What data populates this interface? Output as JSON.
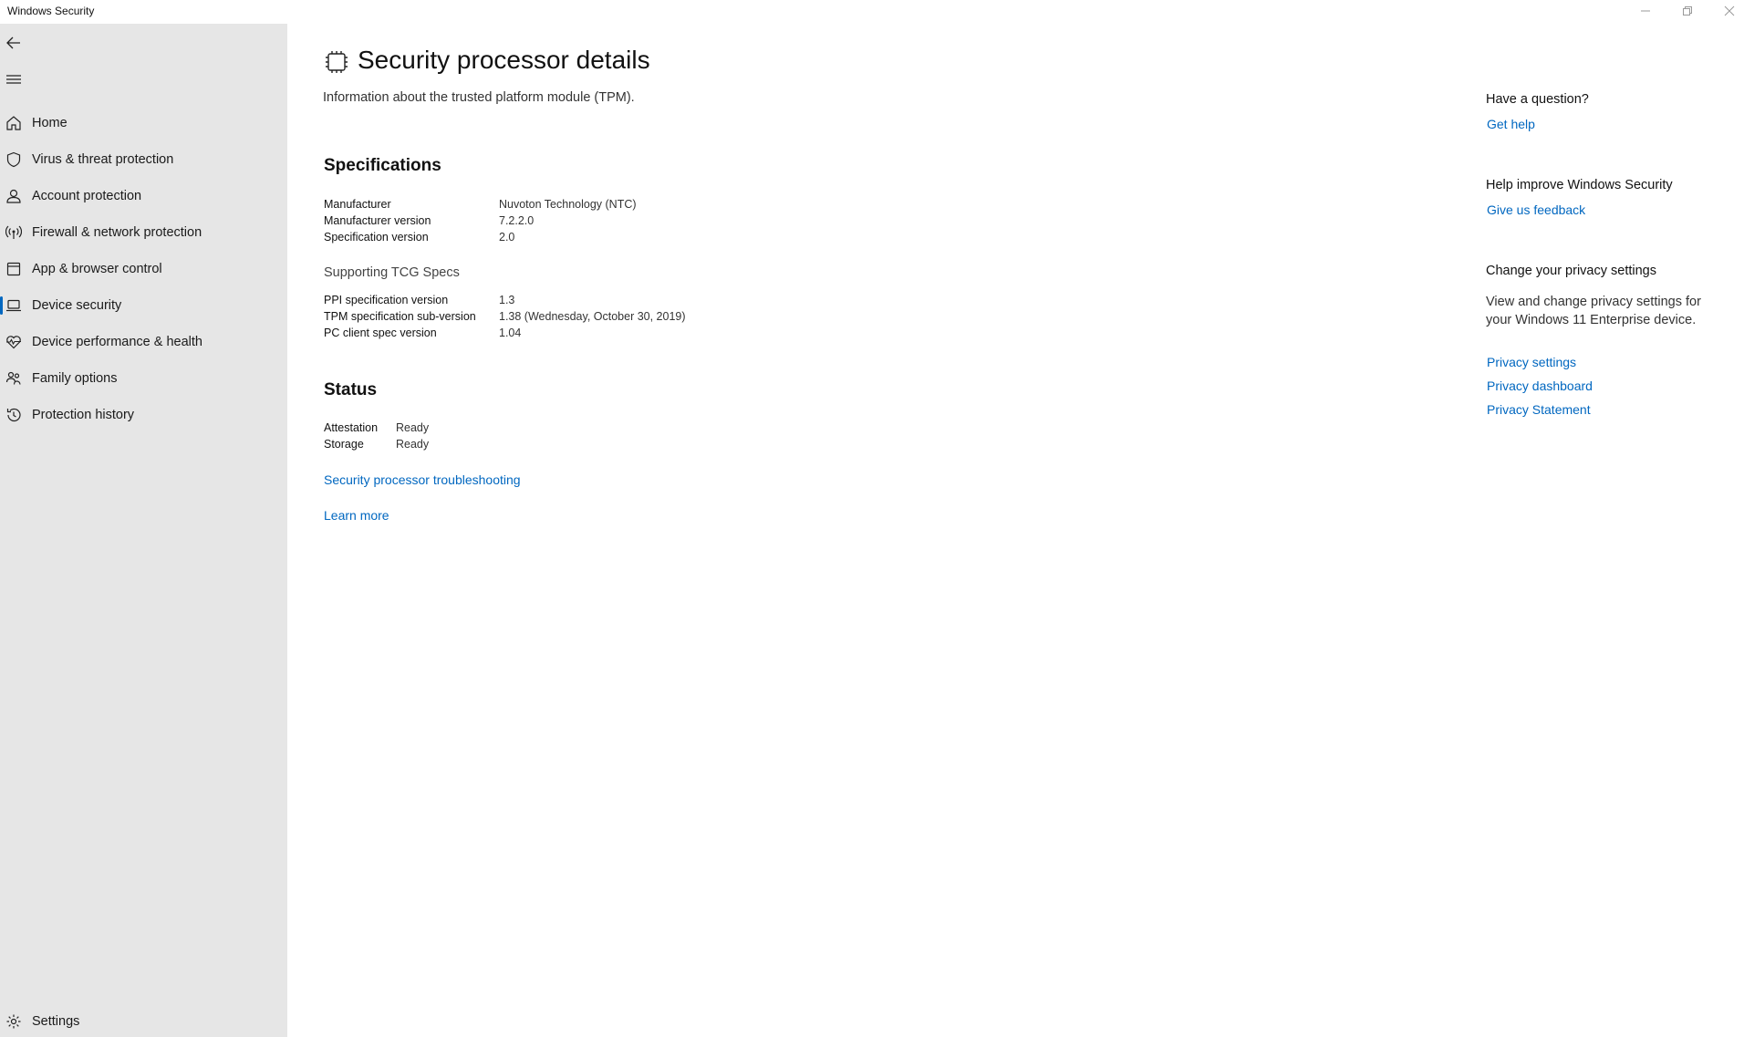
{
  "window": {
    "title": "Windows Security"
  },
  "sidebar": {
    "items": [
      {
        "label": "Home",
        "icon": "home-icon"
      },
      {
        "label": "Virus & threat protection",
        "icon": "shield-icon"
      },
      {
        "label": "Account protection",
        "icon": "person-icon"
      },
      {
        "label": "Firewall & network protection",
        "icon": "antenna-icon"
      },
      {
        "label": "App & browser control",
        "icon": "app-window-icon"
      },
      {
        "label": "Device security",
        "icon": "laptop-icon",
        "active": true
      },
      {
        "label": "Device performance & health",
        "icon": "heart-pulse-icon"
      },
      {
        "label": "Family options",
        "icon": "family-icon"
      },
      {
        "label": "Protection history",
        "icon": "history-icon"
      }
    ],
    "settings_label": "Settings"
  },
  "page": {
    "title": "Security processor details",
    "subtitle": "Information about the trusted platform module (TPM).",
    "specifications": {
      "heading": "Specifications",
      "rows": [
        {
          "key": "Manufacturer",
          "value": "Nuvoton Technology (NTC)"
        },
        {
          "key": "Manufacturer version",
          "value": "7.2.2.0"
        },
        {
          "key": "Specification version",
          "value": "2.0"
        }
      ]
    },
    "tcg": {
      "heading": "Supporting TCG Specs",
      "rows": [
        {
          "key": "PPI specification version",
          "value": "1.3"
        },
        {
          "key": "TPM specification sub-version",
          "value": "1.38 (Wednesday, October 30, 2019)"
        },
        {
          "key": "PC client spec version",
          "value": "1.04"
        }
      ]
    },
    "status": {
      "heading": "Status",
      "rows": [
        {
          "key": "Attestation",
          "value": "Ready"
        },
        {
          "key": "Storage",
          "value": "Ready"
        }
      ]
    },
    "troubleshooting_link": "Security processor troubleshooting",
    "learn_more_link": "Learn more"
  },
  "right_panel": {
    "question_heading": "Have a question?",
    "get_help_link": "Get help",
    "improve_heading": "Help improve Windows Security",
    "feedback_link": "Give us feedback",
    "privacy_heading": "Change your privacy settings",
    "privacy_text": "View and change privacy settings for your Windows 11 Enterprise device.",
    "privacy_links": [
      "Privacy settings",
      "Privacy dashboard",
      "Privacy Statement"
    ]
  },
  "colors": {
    "accent": "#0067c0",
    "sidebar_bg": "#e6e6e6"
  }
}
